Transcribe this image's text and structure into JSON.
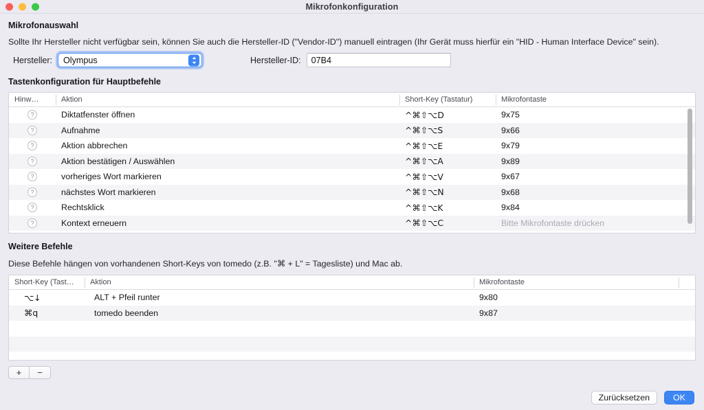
{
  "window": {
    "title": "Mikrofonkonfiguration",
    "traffic_lights": [
      "close-red",
      "minimize-yellow",
      "zoom-green"
    ]
  },
  "mic_selection": {
    "heading": "Mikrofonauswahl",
    "note": "Sollte Ihr Hersteller nicht verfügbar sein, können Sie auch die Hersteller-ID (\"Vendor-ID\") manuell eintragen (Ihr Gerät muss hierfür ein \"HID - Human Interface Device\" sein).",
    "manufacturer_label": "Hersteller:",
    "manufacturer_value": "Olympus",
    "manufacturer_options": [
      "Olympus"
    ],
    "vendor_id_label": "Hersteller-ID:",
    "vendor_id_value": "07B4"
  },
  "main_commands": {
    "heading": "Tastenkonfiguration für Hauptbefehle",
    "columns": [
      "Hinw…",
      "Aktion",
      "Short-Key (Tastatur)",
      "Mikrofontaste"
    ],
    "rows": [
      {
        "hint": "?",
        "action": "Diktatfenster öffnen",
        "shortkey": "^⌘⇧⌥D",
        "mickey": "9x75",
        "mickey_placeholder": false
      },
      {
        "hint": "?",
        "action": "Aufnahme",
        "shortkey": "^⌘⇧⌥S",
        "mickey": "9x66",
        "mickey_placeholder": false
      },
      {
        "hint": "?",
        "action": "Aktion abbrechen",
        "shortkey": "^⌘⇧⌥E",
        "mickey": "9x79",
        "mickey_placeholder": false
      },
      {
        "hint": "?",
        "action": "Aktion bestätigen / Auswählen",
        "shortkey": "^⌘⇧⌥A",
        "mickey": "9x89",
        "mickey_placeholder": false
      },
      {
        "hint": "?",
        "action": "vorheriges Wort markieren",
        "shortkey": "^⌘⇧⌥V",
        "mickey": "9x67",
        "mickey_placeholder": false
      },
      {
        "hint": "?",
        "action": "nächstes Wort markieren",
        "shortkey": "^⌘⇧⌥N",
        "mickey": "9x68",
        "mickey_placeholder": false
      },
      {
        "hint": "?",
        "action": "Rechtsklick",
        "shortkey": "^⌘⇧⌥K",
        "mickey": "9x84",
        "mickey_placeholder": false
      },
      {
        "hint": "?",
        "action": "Kontext erneuern",
        "shortkey": "^⌘⇧⌥C",
        "mickey": "Bitte Mikrofontaste drücken",
        "mickey_placeholder": true
      }
    ]
  },
  "other_commands": {
    "heading": "Weitere Befehle",
    "note": "Diese Befehle hängen von vorhandenen Short-Keys von tomedo (z.B. \"⌘ + L\" = Tagesliste) und Mac ab.",
    "columns": [
      "Short-Key (Tast…",
      "Aktion",
      "Mikrofontaste"
    ],
    "rows": [
      {
        "shortkey": "⌥↓",
        "action": "ALT + Pfeil runter",
        "mickey": "9x80"
      },
      {
        "shortkey": "⌘q",
        "action": "tomedo beenden",
        "mickey": "9x87"
      }
    ],
    "empty_row_count": 3,
    "add_button": "+",
    "remove_button": "−"
  },
  "footer": {
    "reset_label": "Zurücksetzen",
    "ok_label": "OK"
  },
  "colors": {
    "accent": "#3c86f4",
    "window_bg": "#ecebf2",
    "table_bg": "#ffffff",
    "stripe": "#f4f4f7",
    "placeholder_text": "#a9a9b2"
  }
}
